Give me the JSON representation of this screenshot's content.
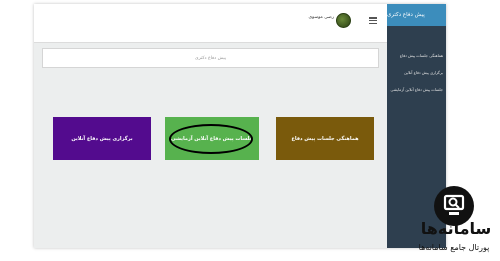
{
  "header": {
    "username": "رضی موسوی"
  },
  "sidebar": {
    "title": "پیش دفاع دکتری",
    "items": [
      {
        "label": "هماهنگی جلسات پیش دفاع"
      },
      {
        "label": "برگزاری پیش دفاع آنلاین"
      },
      {
        "label": "جلسات پیش دفاع آنلاین آزمایشی"
      }
    ]
  },
  "main": {
    "page_title": "پیش دفاع دکتری",
    "tiles": [
      {
        "label": "برگزاری پیش دفاع آنلاین",
        "color": "#530b8e"
      },
      {
        "label": "جلسات پیش دفاع آنلاین آزمایشی",
        "color": "#57b24e"
      },
      {
        "label": "هماهنگی جلسات پیش دفاع",
        "color": "#7a5a0c"
      }
    ]
  },
  "watermark": {
    "title": "سامانه‌ها",
    "subtitle": "پورتال جامع سامانه‌ها"
  }
}
